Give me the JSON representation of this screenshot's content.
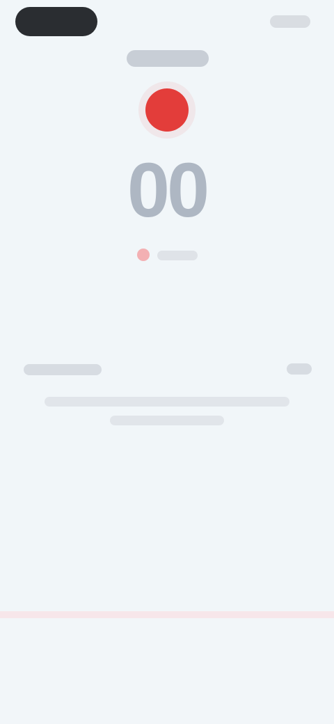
{
  "main": {
    "timer": "00"
  },
  "colors": {
    "background": "#f1f6f9",
    "accent_red": "#e33d3a",
    "timer_gray": "#aeb7c3",
    "status_dark": "#2a2d31",
    "separator_pink": "#f7e6ea"
  }
}
